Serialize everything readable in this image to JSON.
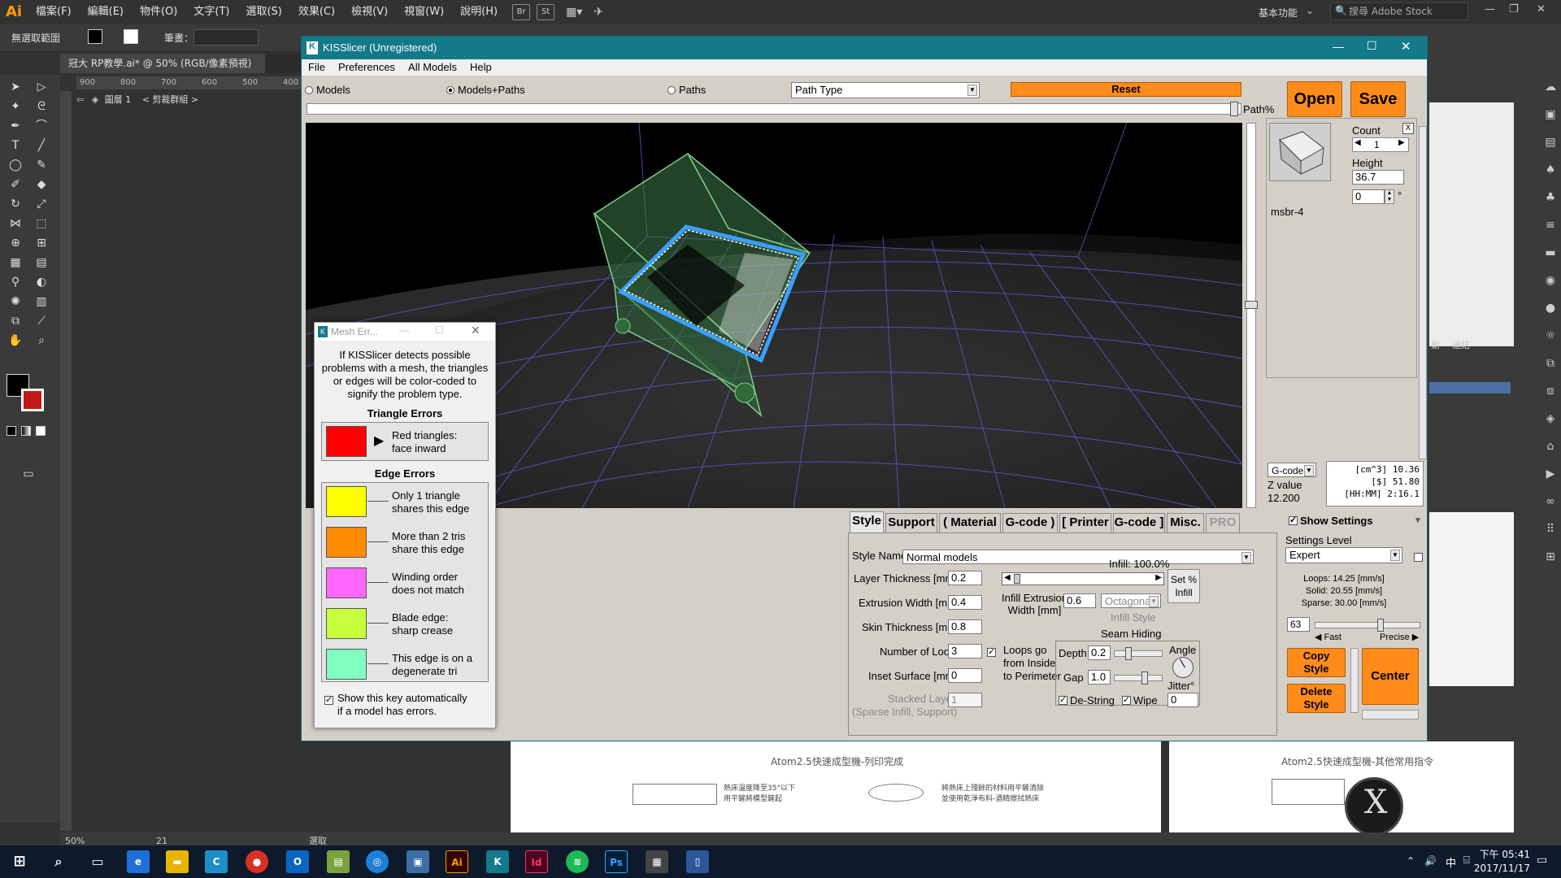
{
  "ai": {
    "logo": "Ai",
    "menus": [
      "檔案(F)",
      "編輯(E)",
      "物件(O)",
      "文字(T)",
      "選取(S)",
      "效果(C)",
      "檢視(V)",
      "視窗(W)",
      "說明(H)"
    ],
    "badges": [
      "Br",
      "St"
    ],
    "workspace": "基本功能",
    "stock_search": "搜尋 Adobe Stock",
    "ctrl_no_selection": "無選取範圍",
    "ctrl_stroke": "筆畫：",
    "doc_tab": "冠大 RP教學.ai* @ 50% (RGB/像素預視)",
    "ruler_ticks": [
      "900",
      "800",
      "700",
      "600",
      "500",
      "400"
    ],
    "layer_label": "圖層 1",
    "clip_group": "< 剪裁群組 >",
    "paper1_title": "Atom2.5快速成型機-列印完成",
    "paper2_title": "Atom2.5快速成型機-其他常用指令",
    "paper1_note1": "熱床溫度降至35°以下\n用平鏟將模型鏟起",
    "paper1_note2": "將熱床上殘餘的材料用平鏟清除\n並使用乾淨布料-酒精擦拭熱床",
    "status_zoom": "50%",
    "status_page": "21",
    "status_mode": "選取",
    "right_tabs": [
      "動",
      "連結"
    ]
  },
  "taskbar": {
    "time": "下午 05:41",
    "date": "2017/11/17",
    "ime": "中"
  },
  "kiss": {
    "title": "KISSlicer (Unregistered)",
    "menu": [
      "File",
      "Preferences",
      "All Models",
      "Help"
    ],
    "view_modes": [
      "Models",
      "Models+Paths",
      "Paths"
    ],
    "view_mode_selected": "Models+Paths",
    "path_type": "Path Type",
    "reset": "Reset",
    "open": "Open",
    "save": "Save",
    "path_pct": "Path%",
    "model": {
      "count_label": "Count",
      "count": "1",
      "height_label": "Height",
      "height": "36.7",
      "rotation": "0",
      "degree": "°",
      "name": "msbr-4",
      "close": "X"
    },
    "gcode": {
      "select": "G-code",
      "z_label": "Z value",
      "z_value": "12.200",
      "stats": [
        "[cm^3] 10.36",
        "[$] 51.80",
        "[HH:MM] 2:16.1"
      ]
    },
    "tabs": [
      "Style",
      "Support",
      "( Material",
      "G-code )",
      "[ Printer",
      "G-code ]",
      "Misc.",
      "PRO"
    ],
    "active_tab": "Style",
    "show_settings": "Show Settings",
    "settings_level_label": "Settings Level",
    "settings_level": "Expert",
    "style": {
      "style_name_label": "Style Name",
      "style_name": "Normal models",
      "layer_thickness_label": "Layer Thickness [mm]",
      "layer_thickness": "0.2",
      "extrusion_width_label": "Extrusion Width [mm]",
      "extrusion_width": "0.4",
      "skin_thickness_label": "Skin Thickness [mm]",
      "skin_thickness": "0.8",
      "loops_label": "Number of Loops",
      "loops": "3",
      "inset_label": "Inset  Surface [mm]",
      "inset": "0",
      "stacked_label": "Stacked Layers",
      "stacked_sub": "(Sparse Infill, Support)",
      "stacked": "1",
      "loops_order": "Loops go\nfrom Inside\nto Perimeter",
      "infill_label": "Infill:",
      "infill_value": "100.0%",
      "infill_fraction": 1.0,
      "set_infill": "Set %\nInfill",
      "infill_ext_label": "Infill Extrusion\nWidth [mm]",
      "infill_ext": "0.6",
      "infill_style": "Octagonal",
      "infill_style_label": "Infill Style",
      "seam_label": "Seam Hiding",
      "depth_label": "Depth",
      "depth": "0.2",
      "gap_label": "Gap",
      "gap": "1.0",
      "angle_label": "Angle",
      "jitter_label": "Jitter°",
      "jitter": "0",
      "destring": "De-String",
      "wipe": "Wipe"
    },
    "speed": {
      "loops": "Loops:  14.25 [mm/s]",
      "solid": "Solid:  20.55 [mm/s]",
      "sparse": "Sparse: 30.00 [mm/s]",
      "value": "63",
      "fast": "Fast",
      "precise": "Precise"
    },
    "copy_style": "Copy\nStyle",
    "delete_style": "Delete\nStyle",
    "center": "Center"
  },
  "mesh": {
    "title": "Mesh Err...",
    "intro": "If KISSlicer detects possible problems with a mesh, the triangles or edges will be color-coded to signify the problem type.",
    "triangle_header": "Triangle Errors",
    "triangle_items": [
      {
        "color": "#ff0000",
        "label": "Red triangles:\nface inward"
      }
    ],
    "edge_header": "Edge Errors",
    "edge_items": [
      {
        "color": "#ffff00",
        "label": "Only 1 triangle\nshares this edge"
      },
      {
        "color": "#ff8c00",
        "label": "More than 2 tris\nshare this edge"
      },
      {
        "color": "#ff66ff",
        "label": "Winding order\ndoes not match"
      },
      {
        "color": "#c8ff3c",
        "label": "Blade edge:\nsharp crease"
      },
      {
        "color": "#80ffc0",
        "label": "This edge is on a\ndegenerate tri"
      }
    ],
    "auto_show": "Show this key automatically\nif a model has errors."
  }
}
